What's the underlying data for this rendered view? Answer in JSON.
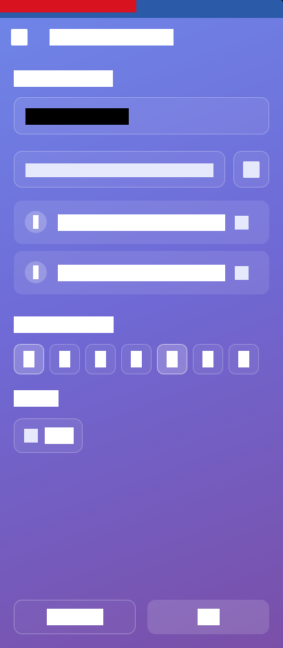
{
  "colors": {
    "accent_red": "#d9121f",
    "accent_blue": "#2a5aa8",
    "background_top": "#6f86e8",
    "background_bottom": "#7a4fa8"
  },
  "header": {
    "back_icon": "arrow-left-icon",
    "title": ""
  },
  "form": {
    "section_1_label": "",
    "value_display": "",
    "input": {
      "value": "",
      "placeholder": ""
    },
    "add_button_icon": "plus-icon",
    "items": [
      {
        "badge_icon": "info-icon",
        "label": "",
        "remove_icon": "close-icon"
      },
      {
        "badge_icon": "info-icon",
        "label": "",
        "remove_icon": "close-icon"
      }
    ],
    "section_2_label": "",
    "day_chips": [
      {
        "label": "",
        "selected": true
      },
      {
        "label": "",
        "selected": false
      },
      {
        "label": "",
        "selected": false
      },
      {
        "label": "",
        "selected": false
      },
      {
        "label": "",
        "selected": true
      },
      {
        "label": "",
        "selected": false
      },
      {
        "label": "",
        "selected": false
      }
    ],
    "section_3_label": "",
    "checkbox": {
      "label": "",
      "checked": false
    }
  },
  "footer": {
    "secondary_button_label": "",
    "primary_button_label": ""
  }
}
